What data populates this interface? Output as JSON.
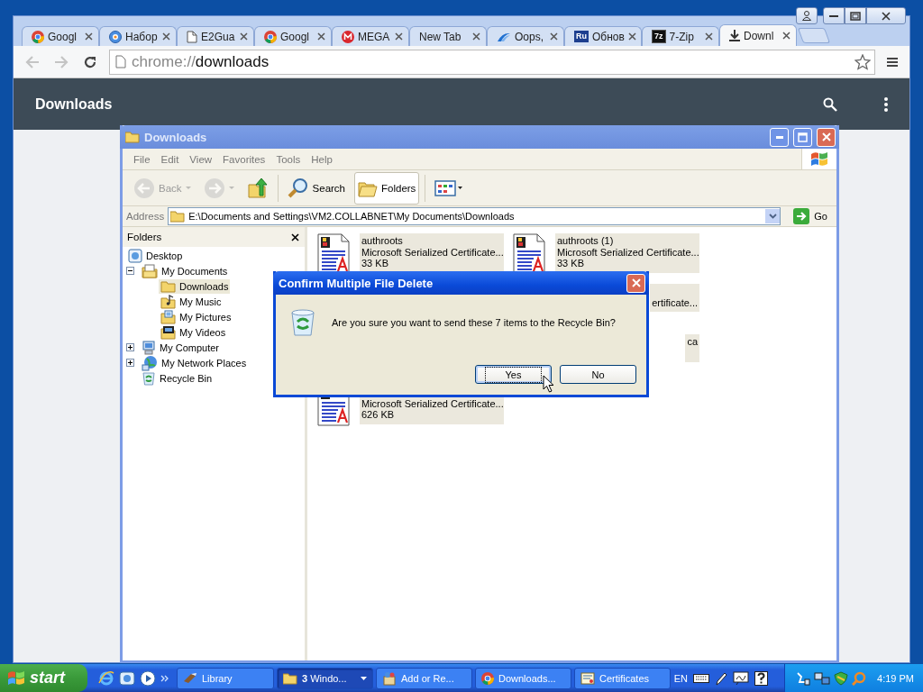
{
  "browser": {
    "tabs": [
      {
        "label": "Googl",
        "kind": "chrome",
        "selected": false
      },
      {
        "label": "Набор",
        "kind": "globe",
        "selected": false
      },
      {
        "label": "E2Gua",
        "kind": "page",
        "selected": false
      },
      {
        "label": "Googl",
        "kind": "chrome",
        "selected": false
      },
      {
        "label": "MEGA",
        "kind": "mega",
        "selected": false
      },
      {
        "label": "New Tab",
        "kind": "none",
        "selected": false
      },
      {
        "label": "Oops,",
        "kind": "cloud",
        "selected": false
      },
      {
        "label": "Обнов",
        "kind": "badge",
        "badge": "Ru",
        "selected": false
      },
      {
        "label": "7-Zip",
        "kind": "badge-dark",
        "badge": "7z",
        "selected": false
      },
      {
        "label": "Downl",
        "kind": "download",
        "selected": true
      }
    ],
    "address": {
      "scheme": "chrome://",
      "path": "downloads"
    },
    "page_title": "Downloads"
  },
  "explorer": {
    "title": "Downloads",
    "menu": [
      "File",
      "Edit",
      "View",
      "Favorites",
      "Tools",
      "Help"
    ],
    "toolbar": [
      {
        "kind": "back",
        "label": "Back",
        "disabled": true,
        "selected": false
      },
      {
        "kind": "forward",
        "disabled": true,
        "selected": false
      },
      {
        "kind": "up",
        "disabled": false,
        "selected": false
      },
      {
        "kind": "search",
        "label": "Search",
        "disabled": false,
        "selected": false
      },
      {
        "kind": "folders",
        "label": "Folders",
        "disabled": false,
        "selected": true
      },
      {
        "kind": "views",
        "disabled": false,
        "selected": false
      }
    ],
    "address": {
      "label": "Address",
      "value": "E:\\Documents and Settings\\VM2.COLLABNET\\My Documents\\Downloads",
      "go": "Go"
    },
    "folders": {
      "title": "Folders",
      "tree": [
        {
          "label": "Desktop",
          "kind": "desktop",
          "selected": false,
          "children": [
            {
              "label": "My Documents",
              "kind": "documents",
              "selected": false,
              "expanded": true,
              "children": [
                {
                  "label": "Downloads",
                  "kind": "folder",
                  "selected": true
                },
                {
                  "label": "My Music",
                  "kind": "music",
                  "selected": false
                },
                {
                  "label": "My Pictures",
                  "kind": "pictures",
                  "selected": false
                },
                {
                  "label": "My Videos",
                  "kind": "videos",
                  "selected": false
                }
              ]
            },
            {
              "label": "My Computer",
              "kind": "computer",
              "selected": false,
              "expanded": false
            },
            {
              "label": "My Network Places",
              "kind": "network",
              "selected": false,
              "expanded": false
            },
            {
              "label": "Recycle Bin",
              "kind": "recycle",
              "selected": false
            }
          ]
        }
      ]
    },
    "files": [
      {
        "kind": "full",
        "name": "authroots",
        "type": "Microsoft Serialized Certificate...",
        "size": "33 KB",
        "selected": true
      },
      {
        "kind": "full",
        "name": "authroots (1)",
        "type": "Microsoft Serialized Certificate...",
        "size": "33 KB",
        "selected": true
      },
      {
        "kind": "cut-left",
        "type": "ertificate...",
        "selected": true
      },
      {
        "kind": "cut-left",
        "name": "ca",
        "selected": true
      },
      {
        "kind": "cut-top",
        "type": "Microsoft Serialized Certificate...",
        "size": "626 KB",
        "selected": true
      }
    ]
  },
  "dialog": {
    "title": "Confirm Multiple File Delete",
    "message": "Are you sure you want to send these 7 items to the Recycle Bin?",
    "buttons": [
      {
        "label": "Yes",
        "focused": true
      },
      {
        "label": "No",
        "focused": false
      }
    ]
  },
  "taskbar": {
    "start": "start",
    "tasks": [
      {
        "label": "Library",
        "kind": "brush",
        "selected": false
      },
      {
        "label": "**3** Windo...",
        "kind": "folder-group",
        "selected": true
      },
      {
        "label": "Add or Re...",
        "kind": "addremove",
        "selected": false
      },
      {
        "label": "Downloads...",
        "kind": "chrome",
        "selected": false
      },
      {
        "label": "Certificates",
        "kind": "cert",
        "selected": false
      }
    ],
    "language": "EN",
    "clock": "4:19 PM"
  }
}
